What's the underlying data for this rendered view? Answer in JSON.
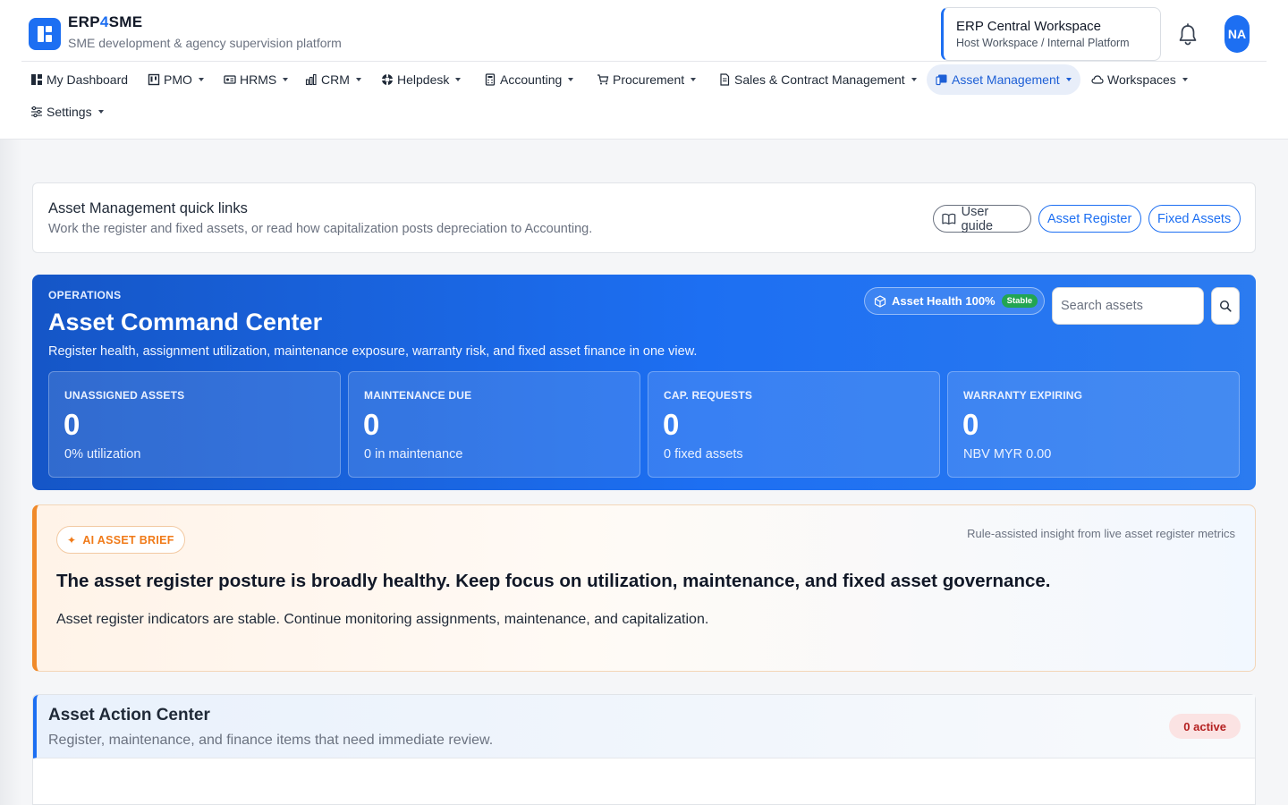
{
  "brand": {
    "name_prefix": "ERP",
    "name_four": "4",
    "name_suffix": "SME",
    "tagline": "SME development & agency supervision platform"
  },
  "workspace": {
    "title": "ERP Central Workspace",
    "subtitle": "Host Workspace / Internal Platform"
  },
  "user": {
    "initials": "NA"
  },
  "nav": {
    "items": [
      {
        "label": "My Dashboard",
        "icon": "dashboard-icon"
      },
      {
        "label": "PMO",
        "icon": "kanban-icon"
      },
      {
        "label": "HRMS",
        "icon": "id-card-icon"
      },
      {
        "label": "CRM",
        "icon": "chart-icon"
      },
      {
        "label": "Helpdesk",
        "icon": "lifebuoy-icon"
      },
      {
        "label": "Accounting",
        "icon": "calculator-icon"
      },
      {
        "label": "Procurement",
        "icon": "cart-icon"
      },
      {
        "label": "Sales & Contract Management",
        "icon": "document-icon"
      },
      {
        "label": "Asset Management",
        "icon": "device-icon",
        "active": true
      },
      {
        "label": "Workspaces",
        "icon": "cloud-icon"
      },
      {
        "label": "Settings",
        "icon": "sliders-icon"
      }
    ]
  },
  "quick_links": {
    "title": "Asset Management quick links",
    "subtitle": "Work the register and fixed assets, or read how capitalization posts depreciation to Accounting.",
    "user_guide": "User guide",
    "asset_register": "Asset Register",
    "fixed_assets": "Fixed Assets"
  },
  "command_center": {
    "kicker": "OPERATIONS",
    "title": "Asset Command Center",
    "subtitle": "Register health, assignment utilization, maintenance exposure, warranty risk, and fixed asset finance in one view.",
    "health_label": "Asset Health 100%",
    "health_status": "Stable",
    "search_placeholder": "Search assets",
    "stats": [
      {
        "label": "UNASSIGNED ASSETS",
        "value": "0",
        "sub": "0% utilization"
      },
      {
        "label": "MAINTENANCE DUE",
        "value": "0",
        "sub": "0 in maintenance"
      },
      {
        "label": "CAP. REQUESTS",
        "value": "0",
        "sub": "0 fixed assets"
      },
      {
        "label": "WARRANTY EXPIRING",
        "value": "0",
        "sub": "NBV MYR 0.00"
      }
    ]
  },
  "ai_brief": {
    "chip": "AI ASSET BRIEF",
    "note": "Rule-assisted insight from live asset register metrics",
    "headline": "The asset register posture is broadly healthy. Keep focus on utilization, maintenance, and fixed asset governance.",
    "text": "Asset register indicators are stable. Continue monitoring assignments, maintenance, and capitalization."
  },
  "action_center": {
    "title": "Asset Action Center",
    "subtitle": "Register, maintenance, and finance items that need immediate review.",
    "badge": "0 active"
  },
  "colors": {
    "primary": "#1d6ff2",
    "accent_orange": "#f08a2a",
    "success": "#22a552",
    "danger_bg": "#fbe3e3"
  }
}
